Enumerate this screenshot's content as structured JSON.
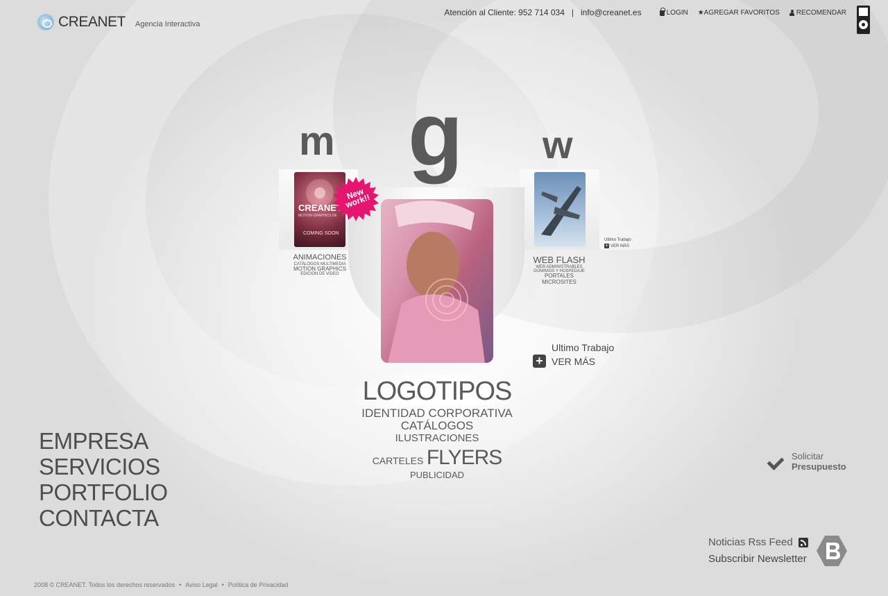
{
  "brand": {
    "name": "CREANET",
    "tagline": "Agencia Interactiva"
  },
  "topbar": {
    "phone_text": "Atención al Cliente: 952 714 034",
    "separator": "|",
    "email": "info@creanet.es",
    "login": "LOGIN",
    "favorites": "★AGREGAR FAVORITOS",
    "recommend": "RECOMENDAR"
  },
  "hero": {
    "letter_m": "m",
    "letter_g": "g",
    "letter_w": "w",
    "left_thumb": {
      "title": "CREANET",
      "subtitle": "MOTION GRAPHICS DE",
      "status": "COMING SOON"
    },
    "badge": "New work!!",
    "left_categories": {
      "title": "ANIMACIONES",
      "line1": "CATÁLOGOS MULTIMEDIA",
      "line2": "MOTION GRAPHICS",
      "line3": "EDICIÓN DE VIDEO"
    },
    "right_categories": {
      "title": "WEB FLASH",
      "line1": "WEB ADMINISTRABLES",
      "line2": "DOMINIOS Y HOSPEDAJE",
      "line3": "PORTALES",
      "line4": "MICROSITES"
    },
    "ultimo_small": {
      "title": "Ultimo Trabajo",
      "link": "VER MÁS"
    },
    "ultimo": {
      "title": "Ultimo Trabajo",
      "link": "VER MÁS"
    },
    "tags": {
      "logotipos": "LOGOTIPOS",
      "identidad": "IDENTIDAD CORPORATIVA",
      "catalogos": "CATÁLOGOS",
      "ilustraciones": "ILUSTRACIONES",
      "carteles": "CARTELES",
      "flyers": "FLYERS",
      "publicidad": "PUBLICIDAD"
    }
  },
  "nav": {
    "items": [
      "EMPRESA",
      "SERVICIOS",
      "PORTFOLIO",
      "CONTACTA"
    ]
  },
  "presupuesto": {
    "line1": "Solicitar",
    "line2": "Presupuesto"
  },
  "rss": {
    "label": "Noticias Rss Feed"
  },
  "newsletter": {
    "label": "Subscribir Newsletter"
  },
  "footer": {
    "copyright": "2008 © CREANET. Todos los derechos reservados",
    "legal": "Aviso Legal",
    "privacy": "Política de Privacidad"
  }
}
